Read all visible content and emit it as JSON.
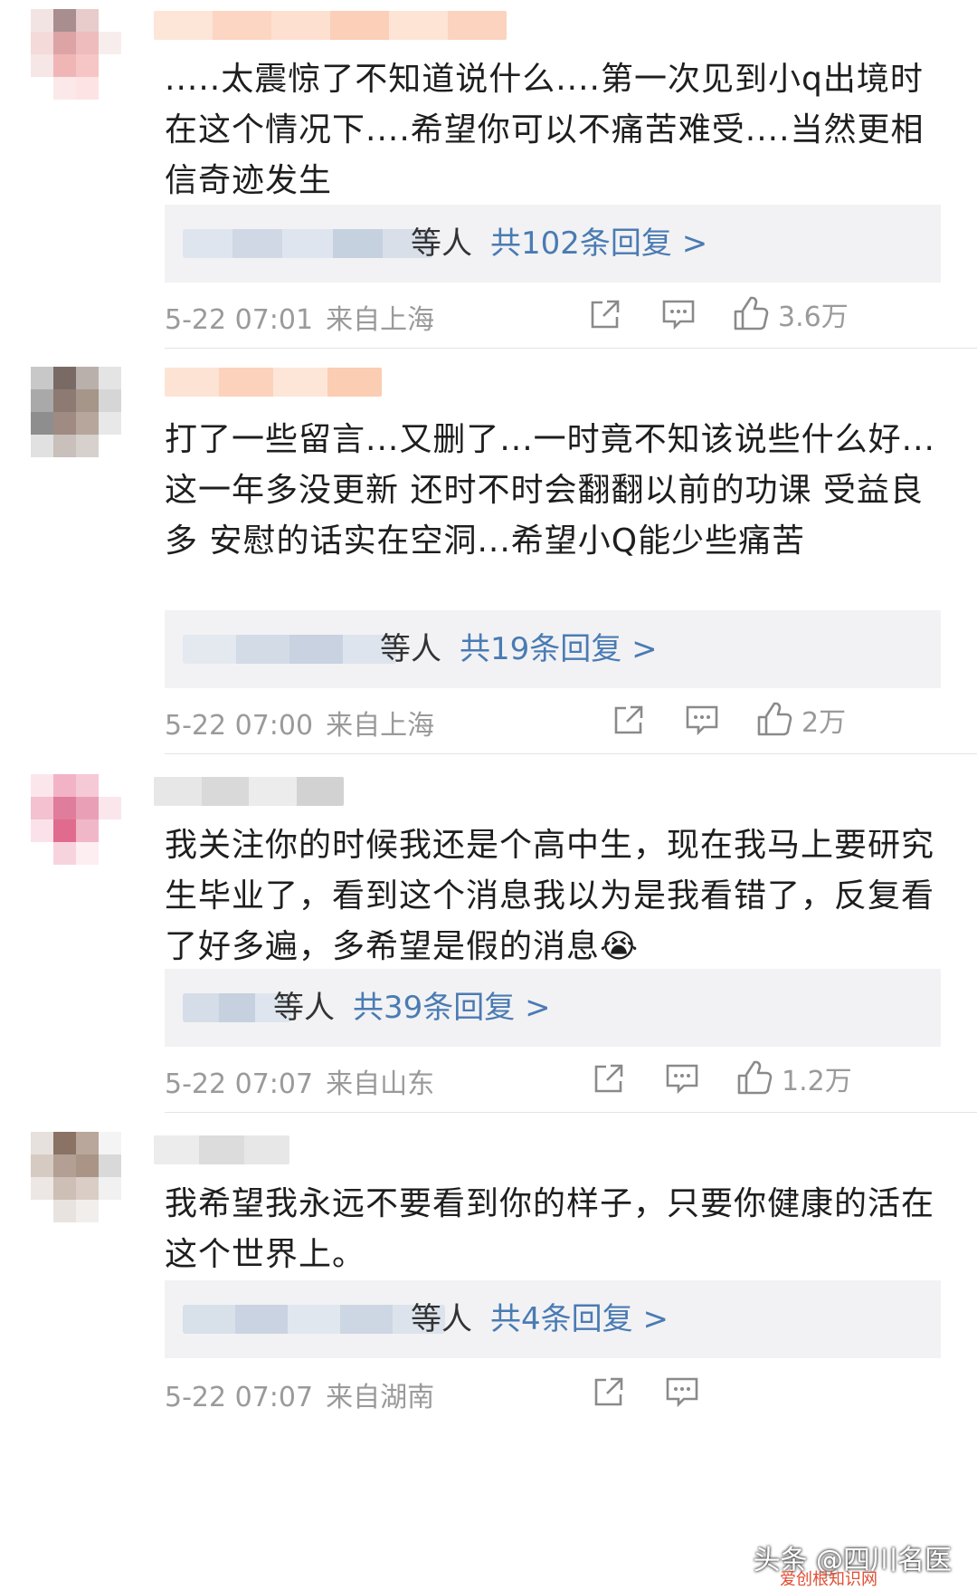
{
  "comments": [
    {
      "text": ".....太震惊了不知道说什么....第一次见到小q出境时在这个情况下....希望你可以不痛苦难受....当然更相信奇迹发生",
      "reply_by": "等人",
      "reply_link": "共102条回复 >",
      "time": "5-22 07:01",
      "location": "来自上海",
      "likes": "3.6万"
    },
    {
      "text": "打了一些留言...又删了...一时竟不知该说些什么好...这一年多没更新 还时不时会翻翻以前的功课 受益良多 安慰的话实在空洞...希望小Q能少些痛苦",
      "reply_by": "等人",
      "reply_link": "共19条回复 >",
      "time": "5-22 07:00",
      "location": "来自上海",
      "likes": "2万"
    },
    {
      "text": "我关注你的时候我还是个高中生，现在我马上要研究生毕业了，看到这个消息我以为是我看错了，反复看了好多遍，多希望是假的消息",
      "emoji": "😭",
      "reply_by": "等人",
      "reply_link": "共39条回复 >",
      "time": "5-22 07:07",
      "location": "来自山东",
      "likes": "1.2万"
    },
    {
      "text": "我希望我永远不要看到你的样子，只要你健康的活在这个世界上。",
      "reply_by": "等人",
      "reply_link": "共4条回复 >",
      "time": "5-22 07:07",
      "location": "来自湖南",
      "likes": ""
    }
  ],
  "watermark": {
    "main": "头条 @四川名医",
    "sub": "爱创根知识网"
  },
  "icons": [
    "share-icon",
    "comment-icon",
    "like-icon"
  ],
  "colors": {
    "link": "#4a7bb3",
    "meta": "#9a9a9a",
    "reply_bg": "#f2f2f4"
  }
}
